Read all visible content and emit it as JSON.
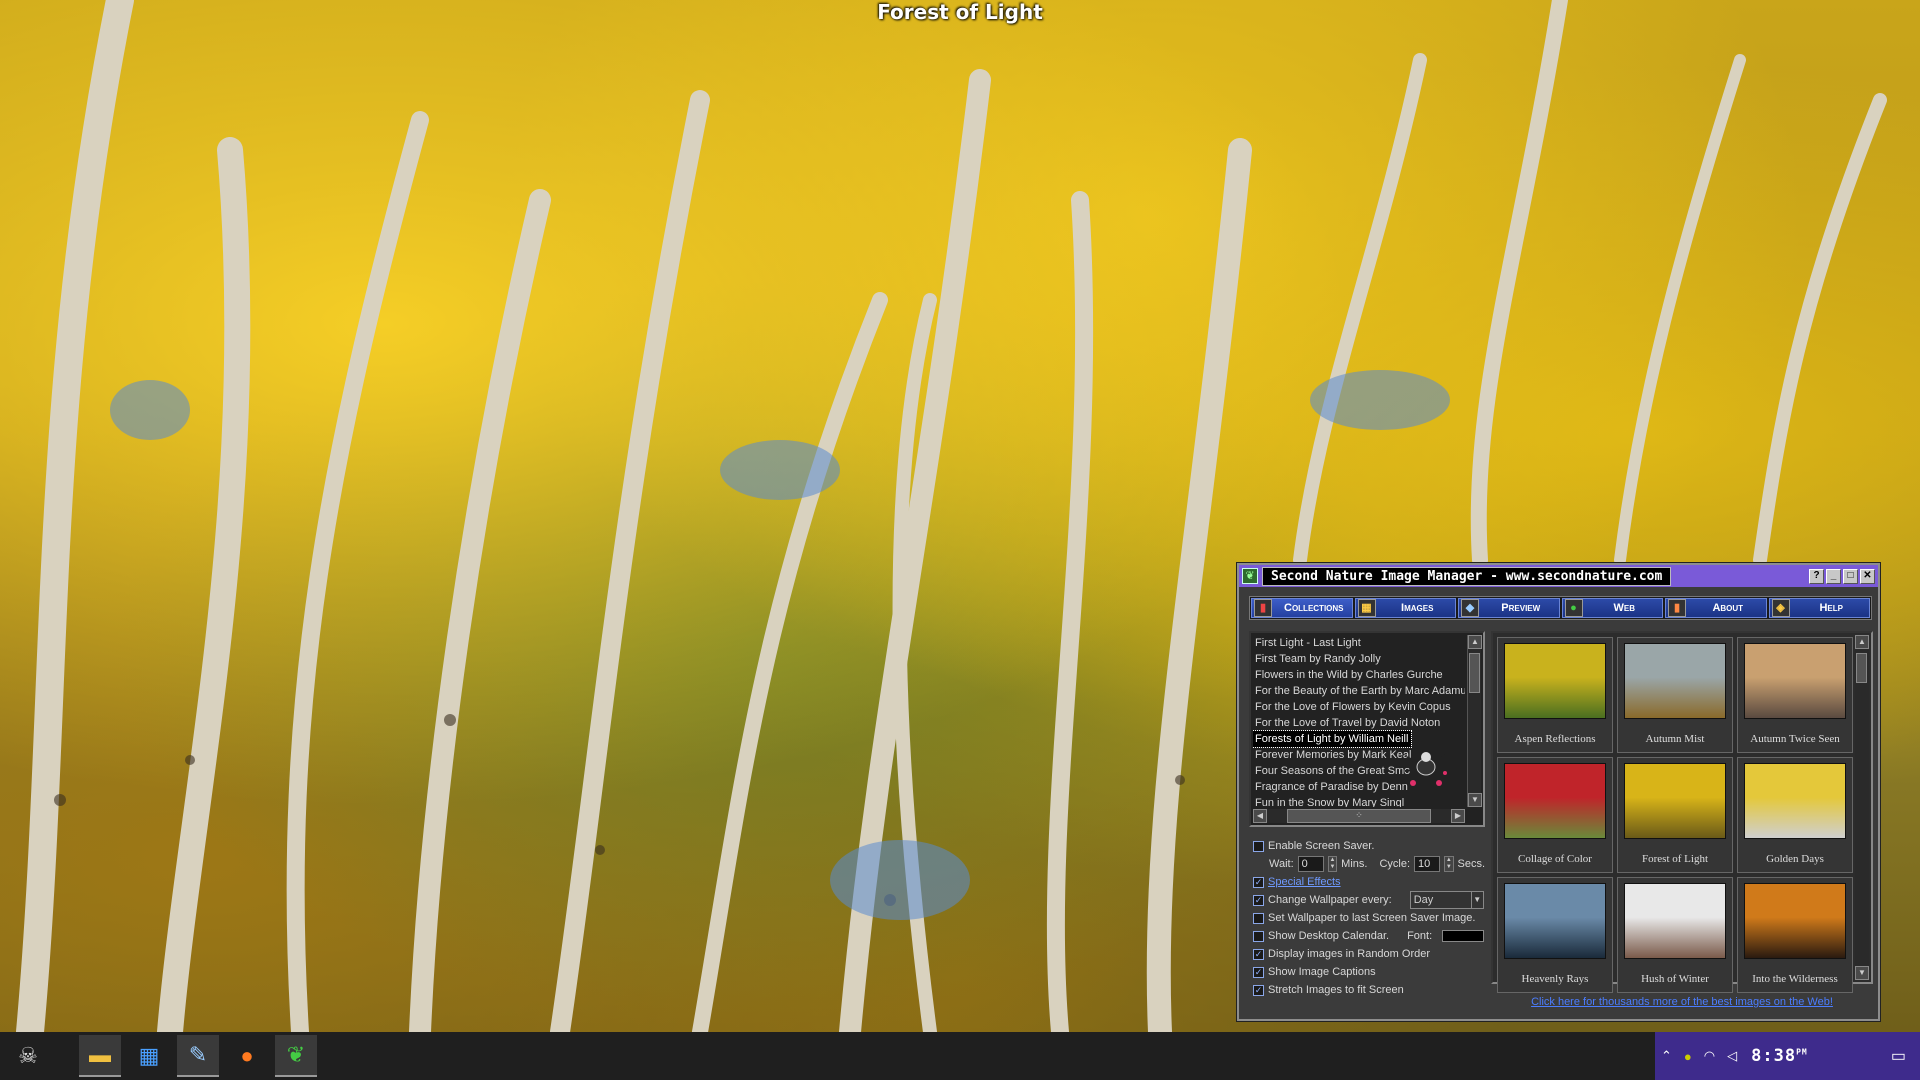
{
  "wallpaper": {
    "caption": "Forest of Light"
  },
  "window": {
    "title": "Second Nature Image Manager - www.secondnature.com",
    "buttons": {
      "help": "?",
      "minimize": "_",
      "maximize": "□",
      "close": "✕"
    }
  },
  "tabs": [
    {
      "label": "Collections"
    },
    {
      "label": "Images"
    },
    {
      "label": "Preview"
    },
    {
      "label": "Web"
    },
    {
      "label": "About"
    },
    {
      "label": "Help"
    }
  ],
  "collections": [
    "First Light - Last Light",
    "First Team by Randy Jolly",
    "Flowers in the Wild by Charles Gurche",
    "For the Beauty of the Earth by Marc Adamus",
    "For the Love of Flowers by Kevin Copus",
    "For the Love of Travel by David Noton",
    "Forests of Light by William Neill",
    "Forever Memories by Mark Keal",
    "Four Seasons of the Great Smo",
    "Fragrance of Paradise by Denn",
    "Fun in the Snow by Mary Singl"
  ],
  "selected_collection": "Forests of Light by William Neill",
  "options": {
    "screen_saver": {
      "label": "Enable Screen Saver.",
      "checked": false
    },
    "wait_label": "Wait:",
    "wait_value": "0",
    "mins_label": "Mins.",
    "cycle_label": "Cycle:",
    "cycle_value": "10",
    "secs_label": "Secs.",
    "special_effects": {
      "label": "Special Effects",
      "checked": true
    },
    "change_wallpaper": {
      "label": "Change Wallpaper every:",
      "checked": true,
      "value": "Day"
    },
    "set_wallpaper": {
      "label": "Set Wallpaper to last Screen Saver Image.",
      "checked": false
    },
    "desktop_calendar": {
      "label": "Show Desktop Calendar.",
      "checked": false,
      "font_label": "Font:"
    },
    "random_order": {
      "label": "Display images in Random Order",
      "checked": true
    },
    "captions": {
      "label": "Show Image Captions",
      "checked": true
    },
    "stretch": {
      "label": "Stretch Images to fit Screen",
      "checked": true
    }
  },
  "thumbnails": [
    {
      "caption": "Aspen Reflections",
      "colors": [
        "#c9b21d",
        "#4a6f20"
      ]
    },
    {
      "caption": "Autumn Mist",
      "colors": [
        "#9aa6a8",
        "#8a6a2a"
      ]
    },
    {
      "caption": "Autumn Twice Seen",
      "colors": [
        "#c9a070",
        "#5a4a40"
      ]
    },
    {
      "caption": "Collage of Color",
      "colors": [
        "#c0242a",
        "#6a8a3a"
      ]
    },
    {
      "caption": "Forest of Light",
      "colors": [
        "#d8b418",
        "#6a5a18"
      ]
    },
    {
      "caption": "Golden Days",
      "colors": [
        "#e4c83a",
        "#cfcfcf"
      ]
    },
    {
      "caption": "Heavenly Rays",
      "colors": [
        "#6a8aa8",
        "#1a2a3a"
      ]
    },
    {
      "caption": "Hush of Winter",
      "colors": [
        "#e8e8e8",
        "#7a5a4a"
      ]
    },
    {
      "caption": "Into the Wilderness",
      "colors": [
        "#d07a1a",
        "#2a1a10"
      ]
    }
  ],
  "web_link": "Click here for thousands more of the best images on the Web!",
  "taskbar": {
    "start_icon": "skull-icon",
    "apps": [
      "file-explorer-icon",
      "store-icon",
      "paint-icon",
      "firefox-icon",
      "second-nature-icon"
    ]
  },
  "tray": {
    "time": "8:38",
    "ampm": "PM"
  }
}
